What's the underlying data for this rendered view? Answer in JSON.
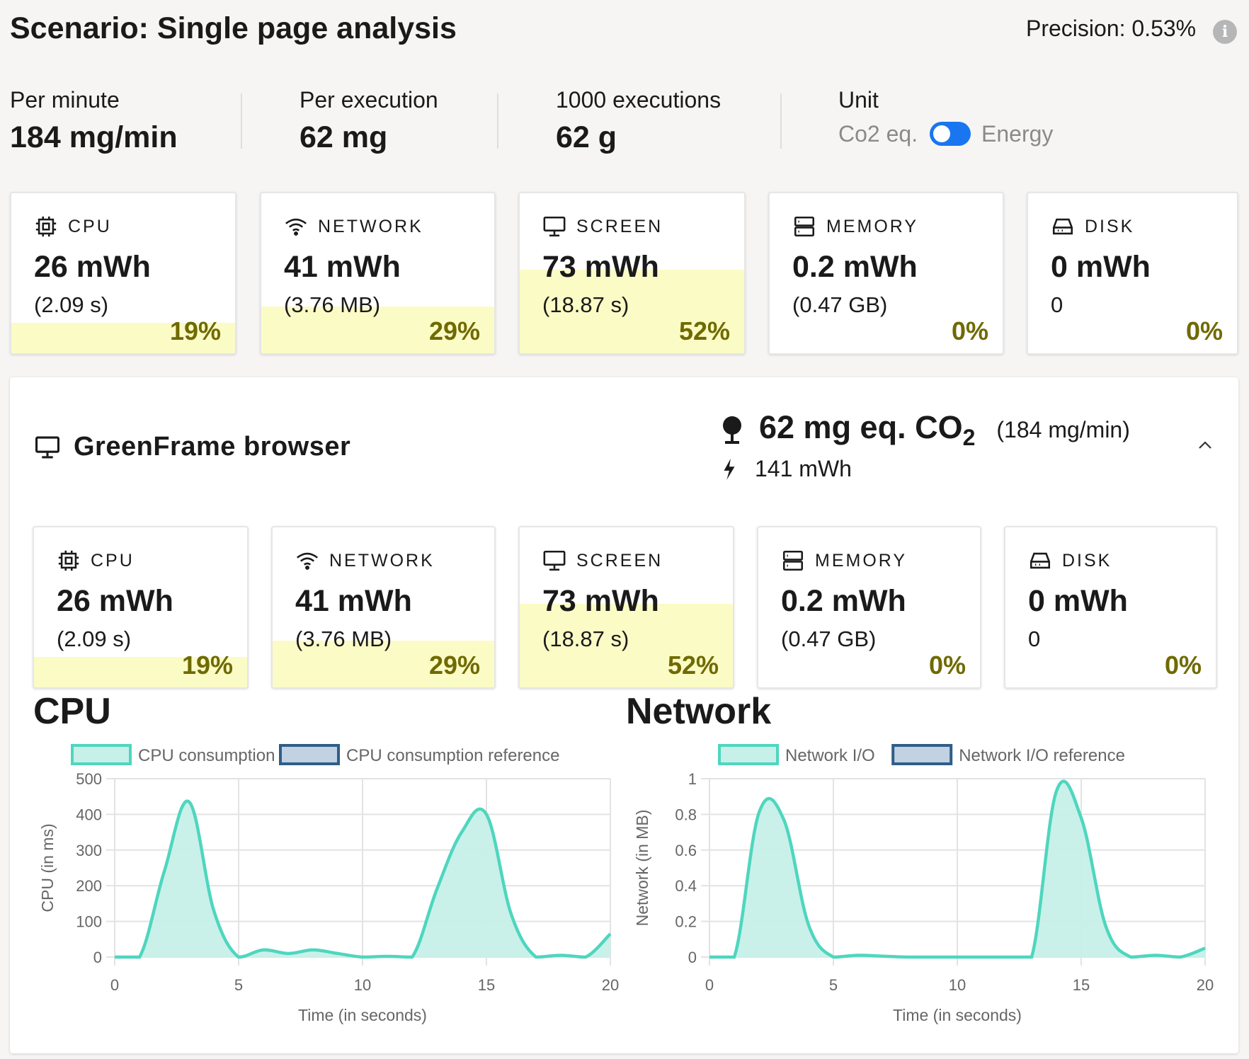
{
  "header": {
    "title": "Scenario: Single page analysis",
    "precision": "Precision: 0.53%",
    "info_icon": "info-icon"
  },
  "summary": {
    "per_minute": {
      "label": "Per minute",
      "value": "184 mg/min"
    },
    "per_execution": {
      "label": "Per execution",
      "value": "62 mg"
    },
    "thousand": {
      "label": "1000 executions",
      "value": "62 g"
    },
    "unit": {
      "label": "Unit",
      "left_option": "Co2 eq.",
      "right_option": "Energy",
      "toggle_state": "Energy"
    }
  },
  "top_cards": [
    {
      "label": "CPU",
      "value": "26 mWh",
      "sub": "(2.09 s)",
      "pct": "19%",
      "fill": 0.19,
      "icon": "cpu-icon"
    },
    {
      "label": "NETWORK",
      "value": "41 mWh",
      "sub": "(3.76 MB)",
      "pct": "29%",
      "fill": 0.29,
      "icon": "wifi-icon"
    },
    {
      "label": "SCREEN",
      "value": "73 mWh",
      "sub": "(18.87 s)",
      "pct": "52%",
      "fill": 0.52,
      "icon": "monitor-icon"
    },
    {
      "label": "MEMORY",
      "value": "0.2 mWh",
      "sub": "(0.47 GB)",
      "pct": "0%",
      "fill": 0,
      "icon": "memory-icon"
    },
    {
      "label": "DISK",
      "value": "0 mWh",
      "sub": "0",
      "pct": "0%",
      "fill": 0,
      "icon": "disk-icon"
    }
  ],
  "browser": {
    "title": "GreenFrame browser",
    "co2_value": "62 mg eq. CO",
    "co2_subscript": "2",
    "co2_rate": "(184 mg/min)",
    "energy": "141 mWh",
    "cards": [
      {
        "label": "CPU",
        "value": "26 mWh",
        "sub": "(2.09 s)",
        "pct": "19%",
        "fill": 0.19,
        "icon": "cpu-icon"
      },
      {
        "label": "NETWORK",
        "value": "41 mWh",
        "sub": "(3.76 MB)",
        "pct": "29%",
        "fill": 0.29,
        "icon": "wifi-icon"
      },
      {
        "label": "SCREEN",
        "value": "73 mWh",
        "sub": "(18.87 s)",
        "pct": "52%",
        "fill": 0.52,
        "icon": "monitor-icon"
      },
      {
        "label": "MEMORY",
        "value": "0.2 mWh",
        "sub": "(0.47 GB)",
        "pct": "0%",
        "fill": 0,
        "icon": "memory-icon"
      },
      {
        "label": "DISK",
        "value": "0 mWh",
        "sub": "0",
        "pct": "0%",
        "fill": 0,
        "icon": "disk-icon"
      }
    ]
  },
  "colors": {
    "accent_fill": "#fbfbc6",
    "pct_text": "#6f6a00",
    "toggle_blue": "#1976f0",
    "series_line": "#4fd6bf",
    "series_area": "#c6f0e8",
    "reference_line": "#2f5e88",
    "reference_fill": "#c2d2e3"
  },
  "chart_data": [
    {
      "type": "area",
      "title": "CPU",
      "xlabel": "Time (in seconds)",
      "ylabel": "CPU (in ms)",
      "xlim": [
        0,
        20
      ],
      "ylim": [
        0,
        500
      ],
      "xticks": [
        0,
        5,
        10,
        15,
        20
      ],
      "yticks": [
        0,
        100,
        200,
        300,
        400,
        500
      ],
      "grid": true,
      "legend": "top",
      "series": [
        {
          "name": "CPU consumption",
          "x": [
            0,
            1,
            2,
            3,
            4,
            5,
            6,
            7,
            8,
            9,
            10,
            11,
            12,
            13,
            14,
            15,
            16,
            17,
            18,
            19,
            20
          ],
          "y": [
            0,
            0,
            240,
            435,
            130,
            0,
            20,
            10,
            20,
            10,
            0,
            2,
            0,
            190,
            350,
            400,
            120,
            0,
            5,
            0,
            65
          ]
        },
        {
          "name": "CPU consumption reference",
          "x": [],
          "y": []
        }
      ]
    },
    {
      "type": "area",
      "title": "Network",
      "xlabel": "Time (in seconds)",
      "ylabel": "Network (in MB)",
      "xlim": [
        0,
        20
      ],
      "ylim": [
        0,
        1.0
      ],
      "xticks": [
        0,
        5,
        10,
        15,
        20
      ],
      "yticks": [
        0,
        0.2,
        0.4,
        0.6,
        0.8,
        1.0
      ],
      "grid": true,
      "legend": "top",
      "series": [
        {
          "name": "Network I/O",
          "x": [
            0,
            1,
            2,
            3,
            4,
            5,
            6,
            7,
            8,
            9,
            10,
            11,
            12,
            13,
            14,
            15,
            16,
            17,
            18,
            19,
            20
          ],
          "y": [
            0,
            0,
            0.81,
            0.77,
            0.18,
            0,
            0.01,
            0.005,
            0,
            0,
            0,
            0,
            0,
            0,
            0.93,
            0.78,
            0.17,
            0,
            0.01,
            0,
            0.05
          ]
        },
        {
          "name": "Network I/O reference",
          "x": [],
          "y": []
        }
      ]
    }
  ]
}
